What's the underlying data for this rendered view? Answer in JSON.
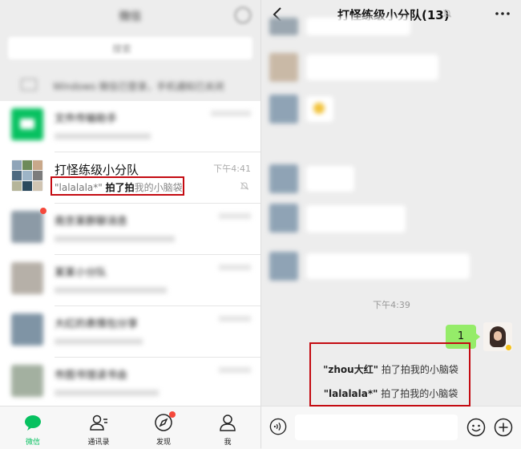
{
  "left": {
    "title": "微信",
    "search_placeholder": "搜索",
    "login_banner": "Windows 微信已登录，手机通知已关闭",
    "chats": [
      {
        "name": "文件传输助手",
        "preview": "",
        "time": "",
        "muted": false,
        "unread": false
      },
      {
        "name": "打怪练级小分队",
        "preview_quote": "\"lalalala*\"",
        "preview_bold": "拍了拍",
        "preview_rest": "我的小脑袋",
        "time": "下午4:41",
        "muted": true,
        "unread": false,
        "active": true
      },
      {
        "name": "南京某群聊消息",
        "preview": "",
        "time": "",
        "muted": false,
        "unread": true
      },
      {
        "name": "某某小分队",
        "preview": "",
        "time": "",
        "muted": false,
        "unread": false
      },
      {
        "name": "大红的表情包分享",
        "preview": "",
        "time": "",
        "muted": false,
        "unread": false
      },
      {
        "name": "市图书馆读书会",
        "preview": "",
        "time": "",
        "muted": false,
        "unread": false
      }
    ],
    "tabs": [
      {
        "label": "微信",
        "icon": "chat-bubble-icon",
        "active": true
      },
      {
        "label": "通讯录",
        "icon": "contacts-icon",
        "active": false
      },
      {
        "label": "发现",
        "icon": "compass-icon",
        "active": false,
        "badge": true
      },
      {
        "label": "我",
        "icon": "person-icon",
        "active": false
      }
    ]
  },
  "right": {
    "chat_title": "打怪练级小分队(13)",
    "messages": [
      {
        "text": ""
      },
      {
        "text": ""
      },
      {
        "text": ""
      },
      {
        "text": ""
      },
      {
        "text": ""
      },
      {
        "text": ""
      }
    ],
    "time_stamp_1": "",
    "time_stamp_2": "下午4:39",
    "my_message": "1",
    "pat_notices": [
      {
        "name": "\"zhou大红\"",
        "action": "拍了拍我的小脑袋"
      },
      {
        "name": "\"lalalala*\"",
        "action": "拍了拍我的小脑袋"
      }
    ]
  },
  "colors": {
    "wechat_green": "#07c160",
    "bubble_green": "#95ec69",
    "highlight_red": "#c40b12",
    "background": "#ededed"
  }
}
